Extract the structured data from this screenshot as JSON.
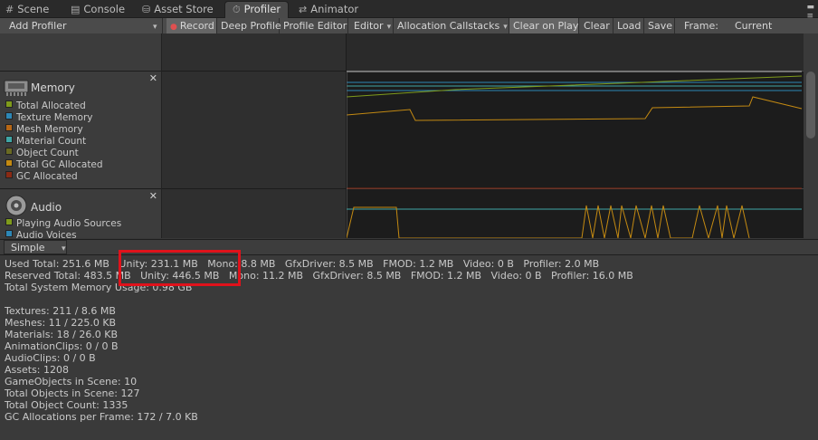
{
  "tabs": [
    {
      "icon": "#",
      "label": "Scene"
    },
    {
      "icon": "▤",
      "label": "Console"
    },
    {
      "icon": "⛁",
      "label": "Asset Store"
    },
    {
      "icon": "⏱",
      "label": "Profiler"
    },
    {
      "icon": "⇄",
      "label": "Animator"
    }
  ],
  "tab_menu_glyph": "▬\n≡",
  "toolbar": {
    "add_profiler": "Add Profiler",
    "record": "Record",
    "record_glyph": "●",
    "deep_profile": "Deep Profile",
    "profile_editor": "Profile Editor",
    "editor": "Editor",
    "allocation_callstacks": "Allocation Callstacks",
    "clear_on_play": "Clear on Play",
    "clear": "Clear",
    "load": "Load",
    "save": "Save",
    "frame_label": "Frame:",
    "frame_value": "Current"
  },
  "modules": {
    "memory": {
      "title": "Memory",
      "close": "✕",
      "items": [
        {
          "label": "Total Allocated",
          "color": "#7f9b1b"
        },
        {
          "label": "Texture Memory",
          "color": "#2d87b6"
        },
        {
          "label": "Mesh Memory",
          "color": "#b76715"
        },
        {
          "label": "Material Count",
          "color": "#3fa6a6"
        },
        {
          "label": "Object Count",
          "color": "#6a6a23"
        },
        {
          "label": "Total GC Allocated",
          "color": "#c48a12"
        },
        {
          "label": "GC Allocated",
          "color": "#8a2a14"
        }
      ]
    },
    "audio": {
      "title": "Audio",
      "close": "✕",
      "items": [
        {
          "label": "Playing Audio Sources",
          "color": "#7f9b1b"
        },
        {
          "label": "Audio Voices",
          "color": "#2d87b6"
        }
      ]
    }
  },
  "view_mode": "Simple",
  "details": [
    "Used Total: 251.6 MB   Unity: 231.1 MB   Mono: 8.8 MB   GfxDriver: 8.5 MB   FMOD: 1.2 MB   Video: 0 B   Profiler: 2.0 MB",
    "Reserved Total: 483.5 MB   Unity: 446.5 MB   Mono: 11.2 MB   GfxDriver: 8.5 MB   FMOD: 1.2 MB   Video: 0 B   Profiler: 16.0 MB",
    "Total System Memory Usage: 0.98 GB",
    "",
    "Textures: 211 / 8.6 MB",
    "Meshes: 11 / 225.0 KB",
    "Materials: 18 / 26.0 KB",
    "AnimationClips: 0 / 0 B",
    "AudioClips: 0 / 0 B",
    "Assets: 1208",
    "GameObjects in Scene: 10",
    "Total Objects in Scene: 127",
    "Total Object Count: 1335",
    "GC Allocations per Frame: 172 / 7.0 KB"
  ]
}
